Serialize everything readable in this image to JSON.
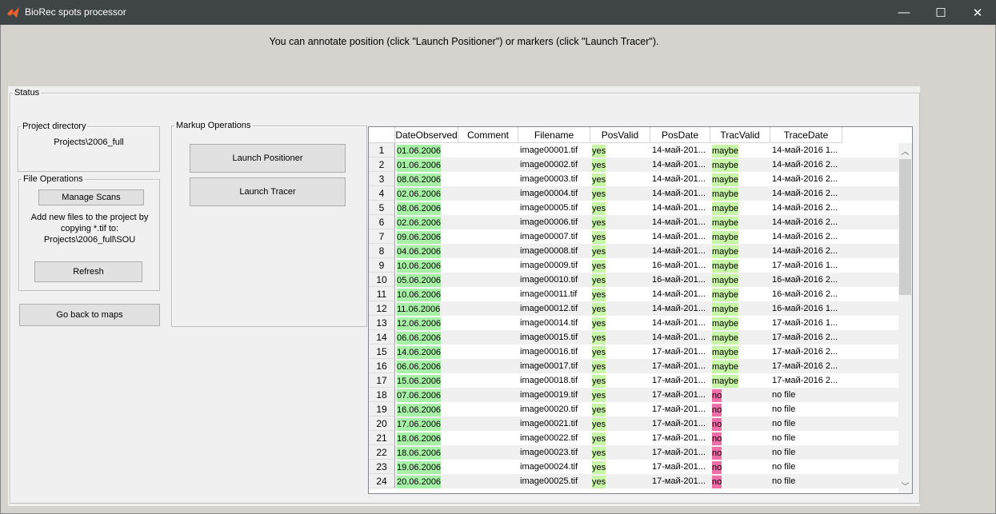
{
  "window": {
    "title": "BioRec spots processor",
    "minimize": "—",
    "maximize": "☐",
    "close": "✕"
  },
  "hint": "You can annotate position (click \"Launch Positioner\") or markers (click \"Launch Tracer\").",
  "status": {
    "label": "Status",
    "project_directory": {
      "label": "Project directory",
      "value": "Projects\\2006_full"
    },
    "file_operations": {
      "label": "File Operations",
      "manage_scans": "Manage Scans",
      "info": "Add new files to the project by copying *.tif to: Projects\\2006_full\\SOU",
      "refresh": "Refresh"
    },
    "go_back": "Go back to maps",
    "markup": {
      "label": "Markup Operations",
      "launch_positioner": "Launch Positioner",
      "launch_tracer": "Launch Tracer"
    }
  },
  "colors": {
    "valid": "#a8f0a8",
    "maybe": "#c8f5a8",
    "invalid": "#f06ea8"
  },
  "table": {
    "columns": [
      "DateObserved",
      "Comment",
      "Filename",
      "PosValid",
      "PosDate",
      "TracValid",
      "TraceDate"
    ],
    "rows": [
      [
        "1",
        "01.06.2006",
        "",
        "image00001.tif",
        "yes",
        "14-май-201...",
        "maybe",
        "14-май-2016 1..."
      ],
      [
        "2",
        "01.06.2006",
        "",
        "image00002.tif",
        "yes",
        "14-май-201...",
        "maybe",
        "14-май-2016 2..."
      ],
      [
        "3",
        "08.06.2006",
        "",
        "image00003.tif",
        "yes",
        "14-май-201...",
        "maybe",
        "14-май-2016 2..."
      ],
      [
        "4",
        "02.06.2006",
        "",
        "image00004.tif",
        "yes",
        "14-май-201...",
        "maybe",
        "14-май-2016 2..."
      ],
      [
        "5",
        "08.06.2006",
        "",
        "image00005.tif",
        "yes",
        "14-май-201...",
        "maybe",
        "14-май-2016 2..."
      ],
      [
        "6",
        "02.06.2006",
        "",
        "image00006.tif",
        "yes",
        "14-май-201...",
        "maybe",
        "14-май-2016 2..."
      ],
      [
        "7",
        "09.06.2006",
        "",
        "image00007.tif",
        "yes",
        "14-май-201...",
        "maybe",
        "14-май-2016 2..."
      ],
      [
        "8",
        "04.06.2006",
        "",
        "image00008.tif",
        "yes",
        "14-май-201...",
        "maybe",
        "14-май-2016 2..."
      ],
      [
        "9",
        "10.06.2006",
        "",
        "image00009.tif",
        "yes",
        "16-май-201...",
        "maybe",
        "17-май-2016 1..."
      ],
      [
        "10",
        "05.06.2006",
        "",
        "image00010.tif",
        "yes",
        "16-май-201...",
        "maybe",
        "16-май-2016 2..."
      ],
      [
        "11",
        "10.06.2006",
        "",
        "image00011.tif",
        "yes",
        "14-май-201...",
        "maybe",
        "16-май-2016 2..."
      ],
      [
        "12",
        "11.06.2006",
        "",
        "image00012.tif",
        "yes",
        "14-май-201...",
        "maybe",
        "16-май-2016 1..."
      ],
      [
        "13",
        "12.06.2006",
        "",
        "image00014.tif",
        "yes",
        "14-май-201...",
        "maybe",
        "17-май-2016 1..."
      ],
      [
        "14",
        "06.06.2006",
        "",
        "image00015.tif",
        "yes",
        "14-май-201...",
        "maybe",
        "17-май-2016 2..."
      ],
      [
        "15",
        "14.06.2006",
        "",
        "image00016.tif",
        "yes",
        "17-май-201...",
        "maybe",
        "17-май-2016 2..."
      ],
      [
        "16",
        "06.06.2006",
        "",
        "image00017.tif",
        "yes",
        "17-май-201...",
        "maybe",
        "17-май-2016 2..."
      ],
      [
        "17",
        "15.06.2006",
        "",
        "image00018.tif",
        "yes",
        "17-май-201...",
        "maybe",
        "17-май-2016 2..."
      ],
      [
        "18",
        "07.06.2006",
        "",
        "image00019.tif",
        "yes",
        "17-май-201...",
        "no",
        "no file"
      ],
      [
        "19",
        "16.06.2006",
        "",
        "image00020.tif",
        "yes",
        "17-май-201...",
        "no",
        "no file"
      ],
      [
        "20",
        "17.06.2006",
        "",
        "image00021.tif",
        "yes",
        "17-май-201...",
        "no",
        "no file"
      ],
      [
        "21",
        "18.06.2006",
        "",
        "image00022.tif",
        "yes",
        "17-май-201...",
        "no",
        "no file"
      ],
      [
        "22",
        "18.06.2006",
        "",
        "image00023.tif",
        "yes",
        "17-май-201...",
        "no",
        "no file"
      ],
      [
        "23",
        "19.06.2006",
        "",
        "image00024.tif",
        "yes",
        "17-май-201...",
        "no",
        "no file"
      ],
      [
        "24",
        "20.06.2006",
        "",
        "image00025.tif",
        "yes",
        "17-май-201...",
        "no",
        "no file"
      ]
    ]
  }
}
